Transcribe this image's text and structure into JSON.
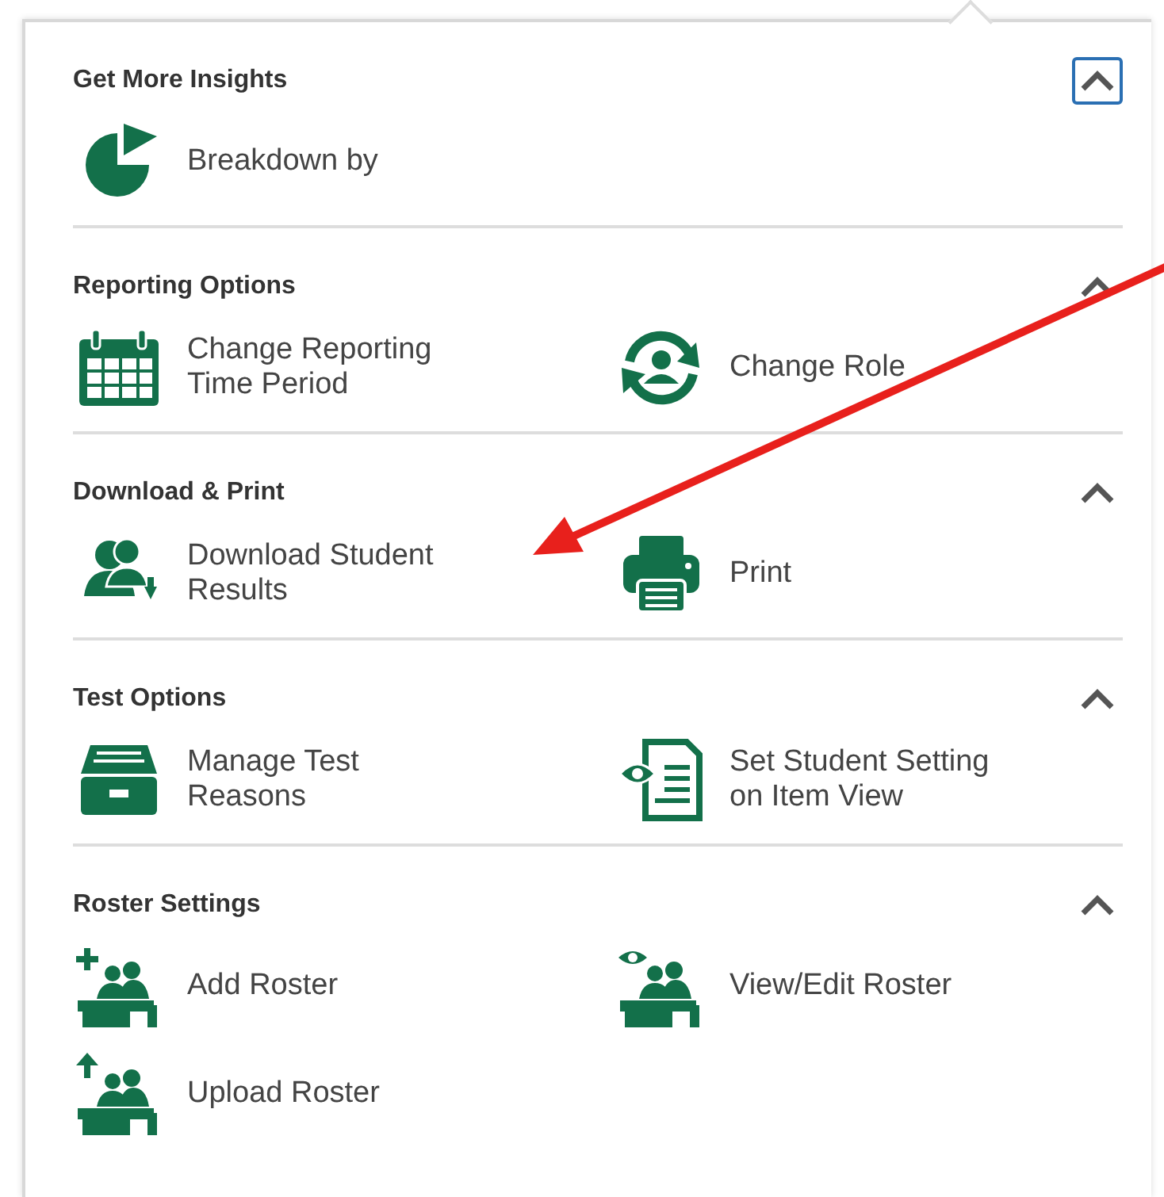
{
  "sections": [
    {
      "title": "Get More Insights",
      "expanded": true,
      "focused": true,
      "items": [
        {
          "kind": "pie",
          "label": "Breakdown by"
        }
      ]
    },
    {
      "title": "Reporting Options",
      "expanded": true,
      "focused": false,
      "items": [
        {
          "kind": "calendar",
          "label": "Change Reporting Time Period"
        },
        {
          "kind": "role",
          "label": "Change Role"
        }
      ]
    },
    {
      "title": "Download & Print",
      "expanded": true,
      "focused": false,
      "items": [
        {
          "kind": "download",
          "label": "Download Student Results"
        },
        {
          "kind": "printer",
          "label": "Print"
        }
      ]
    },
    {
      "title": "Test Options",
      "expanded": true,
      "focused": false,
      "items": [
        {
          "kind": "cabinet",
          "label": "Manage Test Reasons"
        },
        {
          "kind": "document",
          "label": "Set Student Setting on Item View"
        }
      ]
    },
    {
      "title": "Roster Settings",
      "expanded": true,
      "focused": false,
      "items": [
        {
          "kind": "add",
          "label": "Add Roster"
        },
        {
          "kind": "view",
          "label": "View/Edit Roster"
        },
        {
          "kind": "upload",
          "label": "Upload Roster"
        }
      ]
    }
  ],
  "annotation": {
    "kind": "arrow",
    "color": "#e8201c"
  }
}
